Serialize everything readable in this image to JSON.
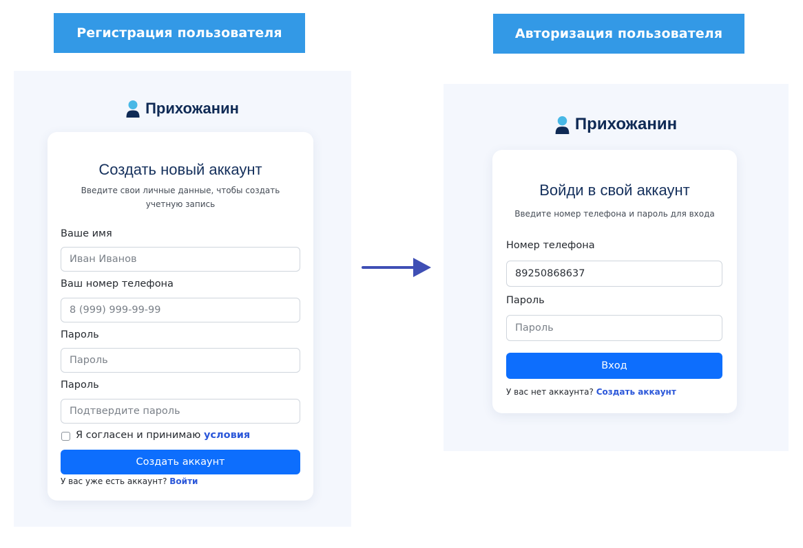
{
  "captions": {
    "registration": "Регистрация пользователя",
    "authorization": "Авторизация пользователя"
  },
  "brand": {
    "name": "Прихожанин",
    "icon": "person-icon",
    "colors": {
      "head": "#48b8e6",
      "body": "#0f2a55"
    }
  },
  "register": {
    "title": "Создать новый аккаунт",
    "subtitle": "Введите свои личные данные, чтобы создать учетную запись",
    "name_label": "Ваше имя",
    "name_placeholder": "Иван Иванов",
    "phone_label": "Ваш номер телефона",
    "phone_placeholder": "8 (999) 999-99-99",
    "password_label": "Пароль",
    "password_placeholder": "Пароль",
    "confirm_label": "Пароль",
    "confirm_placeholder": "Подтвердите пароль",
    "agree_text": "Я согласен и принимаю ",
    "agree_link": "условия",
    "submit_label": "Создать аккаунт",
    "login_prompt": "У вас уже есть аккаунт? ",
    "login_link": "Войти"
  },
  "login": {
    "title": "Войди в свой аккаунт",
    "subtitle": "Введите номер телефона и пароль для входа",
    "phone_label": "Номер телефона",
    "phone_value": "89250868637",
    "password_label": "Пароль",
    "password_placeholder": "Пароль",
    "submit_label": "Вход",
    "register_prompt": "У вас нет аккаунта? ",
    "register_link": "Создать аккаунт"
  },
  "flow_arrow": {
    "icon": "arrow-right-icon",
    "color": "#3f4fb5"
  },
  "colors": {
    "caption_bg": "#3399e6",
    "primary": "#0d6efd",
    "link": "#2b57d9",
    "panel_bg": "#f4f7fd",
    "brand_text": "#0f2a55"
  }
}
